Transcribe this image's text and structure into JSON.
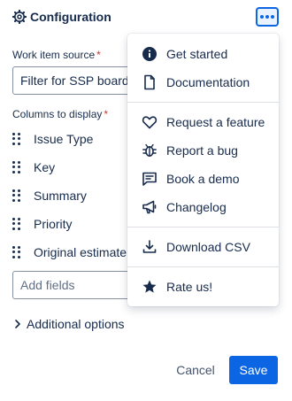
{
  "header": {
    "title": "Configuration",
    "gear_icon": "gear-icon",
    "more_icon": "more-horizontal-icon"
  },
  "form": {
    "source_label": "Work item source",
    "source_value": "Filter for SSP board",
    "required_mark": "*",
    "columns_label": "Columns to display",
    "columns": [
      "Issue Type",
      "Key",
      "Summary",
      "Priority",
      "Original estimate"
    ],
    "add_fields_placeholder": "Add fields",
    "additional_options": "Additional options"
  },
  "footer": {
    "cancel": "Cancel",
    "save": "Save"
  },
  "menu": {
    "group1": [
      {
        "label": "Get started",
        "icon": "info-icon"
      },
      {
        "label": "Documentation",
        "icon": "document-icon"
      }
    ],
    "group2": [
      {
        "label": "Request a feature",
        "icon": "heart-icon"
      },
      {
        "label": "Report a bug",
        "icon": "bug-icon"
      },
      {
        "label": "Book a demo",
        "icon": "chat-icon"
      },
      {
        "label": "Changelog",
        "icon": "megaphone-icon"
      }
    ],
    "group3": [
      {
        "label": "Download CSV",
        "icon": "download-icon"
      }
    ],
    "group4": [
      {
        "label": "Rate us!",
        "icon": "star-icon"
      }
    ]
  },
  "colors": {
    "primary": "#0c66e4",
    "text": "#172b4d",
    "required": "#c9372c",
    "subtle": "#626f86"
  }
}
